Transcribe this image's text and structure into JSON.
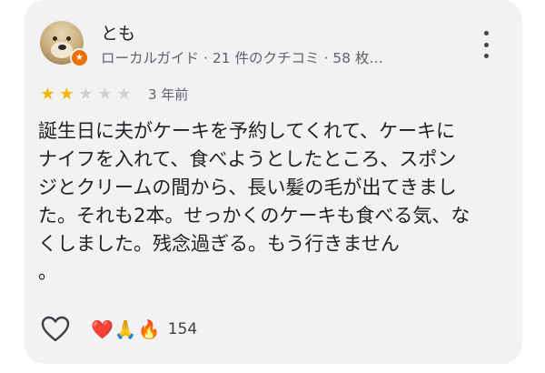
{
  "reviewer": {
    "name": "とも",
    "meta": "ローカルガイド · 21 件のクチコミ · 58 枚…"
  },
  "rating": {
    "stars": 2,
    "max": 5
  },
  "time": "3 年前",
  "review": {
    "text": "誕生日に夫がケーキを予約してくれて、ケーキに\nナイフを入れて、食べようとしたところ、スポン\nジとクリームの間から、長い髪の毛が出てきまし\nた。それも2本。せっかくのケーキも食べる気、な\nくしました。残念過ぎる。もう行きません\n。"
  },
  "reactions": {
    "emojis": [
      "❤️",
      "🙏",
      "🔥"
    ],
    "count": "154"
  },
  "colors": {
    "star_on": "#f4b400",
    "star_off": "#d0d1d4",
    "badge": "#e8710a",
    "card_bg": "#f2f2f4"
  },
  "icons": {
    "like": "heart-outline-icon",
    "more": "more-vertical-icon",
    "guide": "local-guide-star-icon"
  }
}
